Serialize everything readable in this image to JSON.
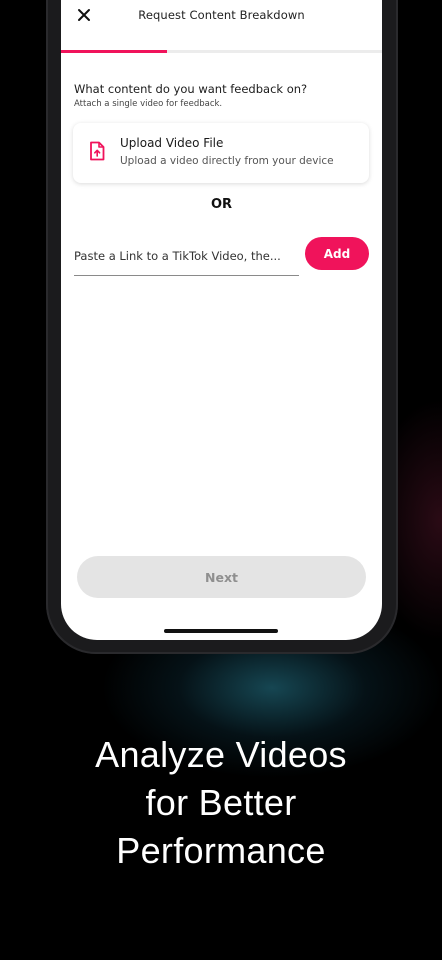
{
  "header": {
    "title": "Request Content Breakdown",
    "close_icon": "close-icon"
  },
  "progress": {
    "fraction": 0.33,
    "color": "#f0135b"
  },
  "content": {
    "question": "What content do you want feedback on?",
    "hint": "Attach a single video for feedback."
  },
  "upload_card": {
    "icon": "file-upload-icon",
    "title": "Upload Video File",
    "subtitle": "Upload a video directly from your device"
  },
  "divider_text": "OR",
  "link_input": {
    "placeholder": "Paste a Link to a TikTok Video, the...",
    "value": ""
  },
  "add_button": {
    "label": "Add"
  },
  "next_button": {
    "label": "Next",
    "disabled": true
  },
  "tagline": {
    "line1": "Analyze Videos",
    "line2": "for Better",
    "line3": "Performance"
  },
  "colors": {
    "accent": "#f0135b",
    "background": "#000000"
  }
}
